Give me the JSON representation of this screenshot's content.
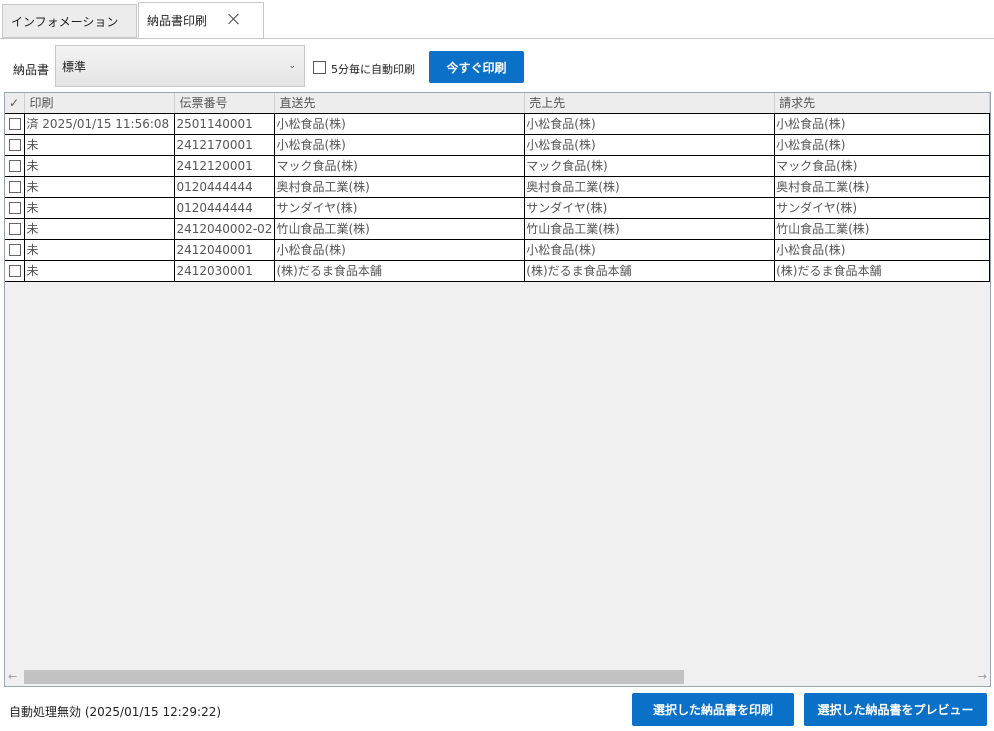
{
  "tabs": [
    {
      "label": "インフォメーション"
    },
    {
      "label": "納品書印刷"
    }
  ],
  "toolbar": {
    "form_label": "納品書",
    "form_value": "標準",
    "auto_print_label": "5分毎に自動印刷",
    "print_now_label": "今すぐ印刷"
  },
  "table": {
    "headers": {
      "check": "✓",
      "print": "印刷",
      "slip_no": "伝票番号",
      "ship_to": "直送先",
      "sold_to": "売上先",
      "bill_to": "請求先"
    },
    "rows": [
      {
        "print": "済 2025/01/15 11:56:08",
        "slip_no": "2501140001",
        "ship_to": "小松食品(株)",
        "sold_to": "小松食品(株)",
        "bill_to": "小松食品(株)"
      },
      {
        "print": "未",
        "slip_no": "2412170001",
        "ship_to": "小松食品(株)",
        "sold_to": "小松食品(株)",
        "bill_to": "小松食品(株)"
      },
      {
        "print": "未",
        "slip_no": "2412120001",
        "ship_to": "マック食品(株)",
        "sold_to": "マック食品(株)",
        "bill_to": "マック食品(株)"
      },
      {
        "print": "未",
        "slip_no": "0120444444",
        "ship_to": "奥村食品工業(株)",
        "sold_to": "奥村食品工業(株)",
        "bill_to": "奥村食品工業(株)"
      },
      {
        "print": "未",
        "slip_no": "0120444444",
        "ship_to": "サンダイヤ(株)",
        "sold_to": "サンダイヤ(株)",
        "bill_to": "サンダイヤ(株)"
      },
      {
        "print": "未",
        "slip_no": "2412040002-02",
        "ship_to": "竹山食品工業(株)",
        "sold_to": "竹山食品工業(株)",
        "bill_to": "竹山食品工業(株)"
      },
      {
        "print": "未",
        "slip_no": "2412040001",
        "ship_to": "小松食品(株)",
        "sold_to": "小松食品(株)",
        "bill_to": "小松食品(株)"
      },
      {
        "print": "未",
        "slip_no": "2412030001",
        "ship_to": "(株)だるま食品本舗",
        "sold_to": "(株)だるま食品本舗",
        "bill_to": "(株)だるま食品本舗"
      }
    ]
  },
  "scrollbar": {
    "left": "←",
    "right": "→"
  },
  "status": {
    "text": "自動処理無効 (2025/01/15 12:29:22)"
  },
  "actions": {
    "print_selected": "選択した納品書を印刷",
    "preview_selected": "選択した納品書をプレビュー"
  },
  "colors": {
    "accent": "#0b70c7"
  }
}
